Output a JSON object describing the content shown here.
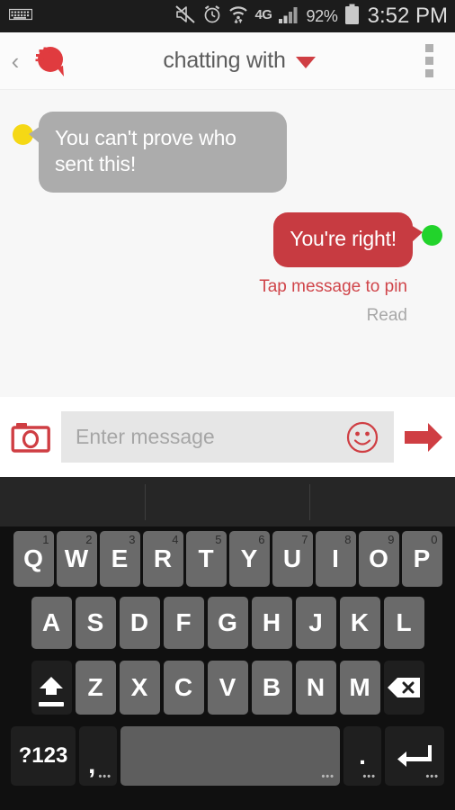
{
  "status_bar": {
    "keyboard_icon": "keyboard-icon",
    "mute_icon": "mute-icon",
    "alarm_icon": "alarm-clock-icon",
    "wifi_icon": "wifi-icon",
    "network_label": "4G",
    "signal_icon": "signal-bars-icon",
    "battery_percent": "92%",
    "battery_icon": "battery-icon",
    "time": "3:52 PM"
  },
  "app_bar": {
    "back_icon": "back-chevron-icon",
    "logo_icon": "app-logo-icon",
    "title": "chatting with",
    "caret_icon": "chevron-down-icon",
    "menu_icon": "overflow-menu-icon"
  },
  "chat": {
    "messages": [
      {
        "direction": "incoming",
        "text": "You can't prove who sent this!",
        "avatar_color": "#f5d815",
        "bubble_color": "#acacac"
      },
      {
        "direction": "outgoing",
        "text": "You're right!",
        "avatar_color": "#22d32b",
        "bubble_color": "#c73b41",
        "hint": "Tap message to pin",
        "status": "Read"
      }
    ]
  },
  "input_bar": {
    "camera_icon": "camera-icon",
    "placeholder": "Enter message",
    "value": "",
    "emoji_icon": "smiley-icon",
    "send_icon": "send-arrow-icon"
  },
  "keyboard": {
    "suggestions": [
      "",
      "",
      ""
    ],
    "row1": [
      {
        "label": "Q",
        "sup": "1"
      },
      {
        "label": "W",
        "sup": "2"
      },
      {
        "label": "E",
        "sup": "3"
      },
      {
        "label": "R",
        "sup": "4"
      },
      {
        "label": "T",
        "sup": "5"
      },
      {
        "label": "Y",
        "sup": "6"
      },
      {
        "label": "U",
        "sup": "7"
      },
      {
        "label": "I",
        "sup": "8"
      },
      {
        "label": "O",
        "sup": "9"
      },
      {
        "label": "P",
        "sup": "0"
      }
    ],
    "row2": [
      "A",
      "S",
      "D",
      "F",
      "G",
      "H",
      "J",
      "K",
      "L"
    ],
    "row3": {
      "shift_icon": "shift-icon",
      "letters": [
        "Z",
        "X",
        "C",
        "V",
        "B",
        "N",
        "M"
      ],
      "backspace_icon": "backspace-icon"
    },
    "row4": {
      "symbols_label": "?123",
      "comma_label": ",",
      "space_label": "",
      "period_label": ".",
      "enter_icon": "enter-icon"
    }
  },
  "colors": {
    "brand_red": "#c73b41",
    "hint_red": "#d0454a",
    "incoming_gray": "#acacac",
    "chat_bg": "#f7f7f7",
    "keyboard_bg": "#101010",
    "key_gray": "#6a6a6a"
  }
}
